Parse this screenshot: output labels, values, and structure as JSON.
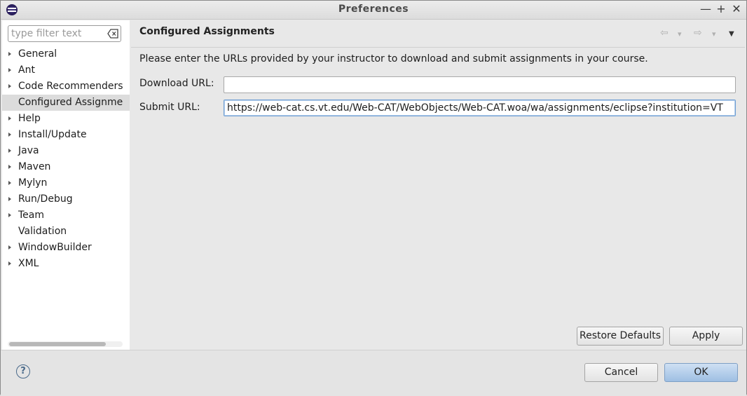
{
  "window": {
    "title": "Preferences",
    "controls": [
      "—",
      "+",
      "✕"
    ]
  },
  "filter": {
    "placeholder": "type filter text"
  },
  "tree": [
    {
      "label": "General",
      "expandable": true
    },
    {
      "label": "Ant",
      "expandable": true
    },
    {
      "label": "Code Recommenders",
      "expandable": true
    },
    {
      "label": "Configured Assignme",
      "expandable": false,
      "selected": true
    },
    {
      "label": "Help",
      "expandable": true
    },
    {
      "label": "Install/Update",
      "expandable": true
    },
    {
      "label": "Java",
      "expandable": true
    },
    {
      "label": "Maven",
      "expandable": true
    },
    {
      "label": "Mylyn",
      "expandable": true
    },
    {
      "label": "Run/Debug",
      "expandable": true
    },
    {
      "label": "Team",
      "expandable": true
    },
    {
      "label": "Validation",
      "expandable": false
    },
    {
      "label": "WindowBuilder",
      "expandable": true
    },
    {
      "label": "XML",
      "expandable": true
    }
  ],
  "page": {
    "title": "Configured Assignments",
    "description": "Please enter the URLs provided by your instructor to download and submit assignments in your course.",
    "download_label": "Download URL:",
    "download_value": "",
    "submit_label": "Submit URL:",
    "submit_value": "https://web-cat.cs.vt.edu/Web-CAT/WebObjects/Web-CAT.woa/wa/assignments/eclipse?institution=VT",
    "restore_defaults": "Restore Defaults",
    "apply": "Apply"
  },
  "nav": {
    "back": "⇦",
    "forward": "⇨",
    "dropdown": "▾",
    "menu": "▼"
  },
  "footer": {
    "help": "?",
    "cancel": "Cancel",
    "ok": "OK"
  },
  "colors": {
    "primary_button": "#9ebfe3",
    "selection": "#dcdcdc",
    "focus_border": "#6d9ed3"
  }
}
